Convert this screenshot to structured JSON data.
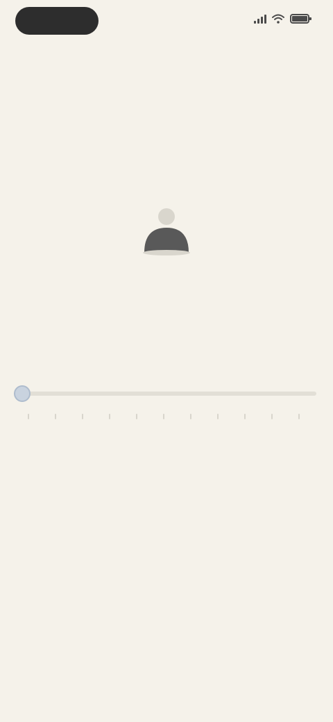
{
  "status_bar": {
    "time": ""
  },
  "header": {
    "title": "",
    "subtitle": ""
  },
  "question": {
    "kicker": "",
    "text": ""
  },
  "slider": {
    "value_fraction": 0.0,
    "scale_labels": [
      "",
      "",
      "",
      "",
      "",
      "",
      "",
      "",
      "",
      "",
      ""
    ]
  },
  "colors": {
    "background": "#f5f2ea",
    "text": "#3a3a3a",
    "status_pill": "#2d2d2d",
    "person_icon": "#595959",
    "slider_track": "#e2dfd6",
    "slider_thumb": "#c9d3df",
    "muted_text": "#a8a59d"
  },
  "icons": {
    "signal": "signal-icon",
    "wifi": "wifi-icon",
    "battery": "battery-icon",
    "person": "person-icon"
  }
}
